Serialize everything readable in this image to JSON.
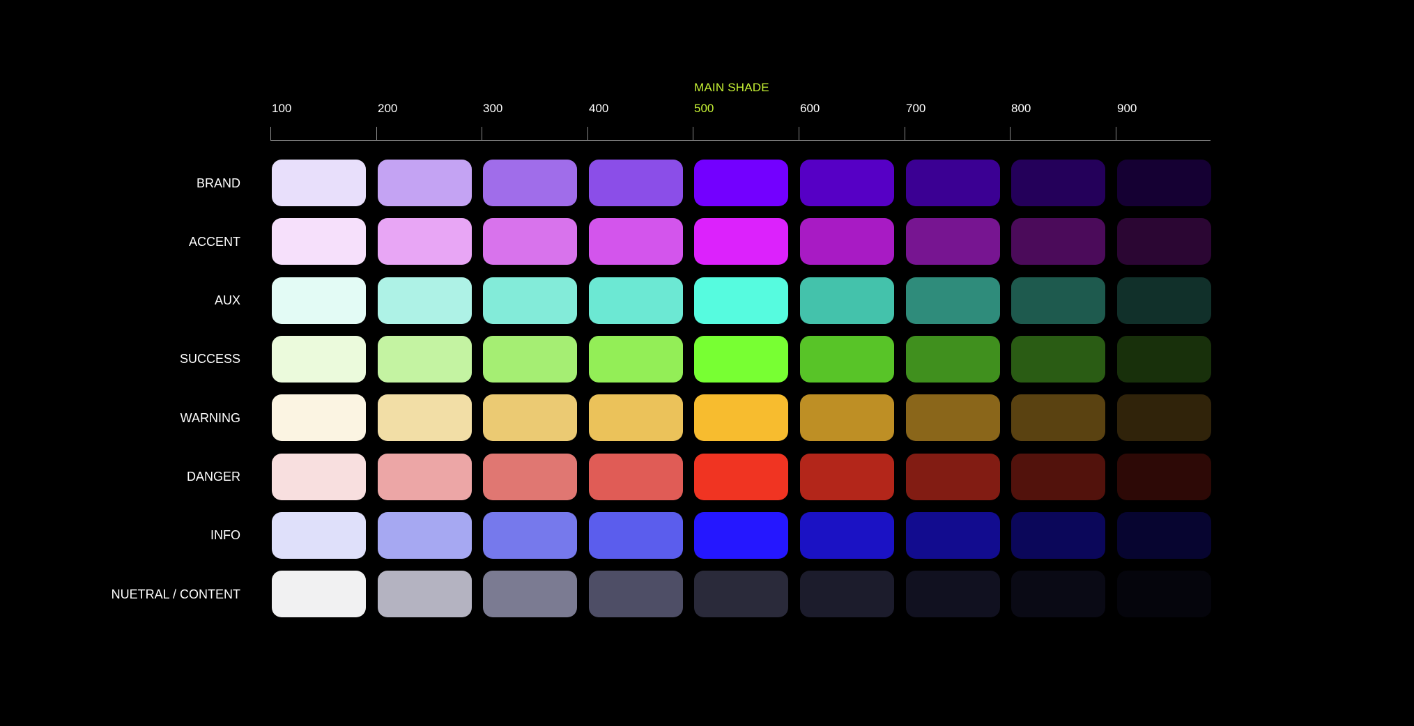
{
  "header": {
    "main_shade_label": "MAIN SHADE",
    "main_shade_color": "#c6f135",
    "main_shade_index": 4
  },
  "shades": [
    "100",
    "200",
    "300",
    "400",
    "500",
    "600",
    "700",
    "800",
    "900"
  ],
  "palettes": [
    {
      "name": "BRAND",
      "colors": [
        "#e8dffb",
        "#c4a3f3",
        "#a06dea",
        "#8b4ee8",
        "#7300ff",
        "#5600c5",
        "#3b0093",
        "#24005a",
        "#150033"
      ]
    },
    {
      "name": "ACCENT",
      "colors": [
        "#f6e0fb",
        "#e8a6f5",
        "#d873ec",
        "#d355ec",
        "#dc22fc",
        "#a81bc4",
        "#771591",
        "#4b0b5a",
        "#2b0633"
      ]
    },
    {
      "name": "AUX",
      "colors": [
        "#e3fbf5",
        "#aef2e6",
        "#83ebd9",
        "#6ce8d3",
        "#56fbdf",
        "#44c2ab",
        "#2f8c7b",
        "#1e5a4e",
        "#11302a"
      ]
    },
    {
      "name": "SUCCESS",
      "colors": [
        "#ebfadc",
        "#c4f3a2",
        "#a5ee73",
        "#93ee57",
        "#78ff33",
        "#58c428",
        "#40901e",
        "#2a5c14",
        "#18300b"
      ]
    },
    {
      "name": "WARNING",
      "colors": [
        "#fbf4e2",
        "#f2dea6",
        "#ebca73",
        "#ebc25a",
        "#f7bc2f",
        "#be8f25",
        "#8a661a",
        "#5a4211",
        "#30230a"
      ]
    },
    {
      "name": "DANGER",
      "colors": [
        "#f8dfdf",
        "#eca6a6",
        "#e07772",
        "#e05c56",
        "#f03422",
        "#b3261a",
        "#821c13",
        "#52120c",
        "#2d0906"
      ]
    },
    {
      "name": "INFO",
      "colors": [
        "#dfe0fa",
        "#a6a8f2",
        "#7679ec",
        "#5b5ded",
        "#2517ff",
        "#1b12c4",
        "#120c8f",
        "#0b075a",
        "#070530"
      ]
    },
    {
      "name": "NUETRAL / CONTENT",
      "colors": [
        "#f1f1f2",
        "#b4b3c1",
        "#7b7b92",
        "#4e4e66",
        "#2a2a3a",
        "#1c1c2c",
        "#111120",
        "#0a0a15",
        "#05050c"
      ]
    }
  ]
}
